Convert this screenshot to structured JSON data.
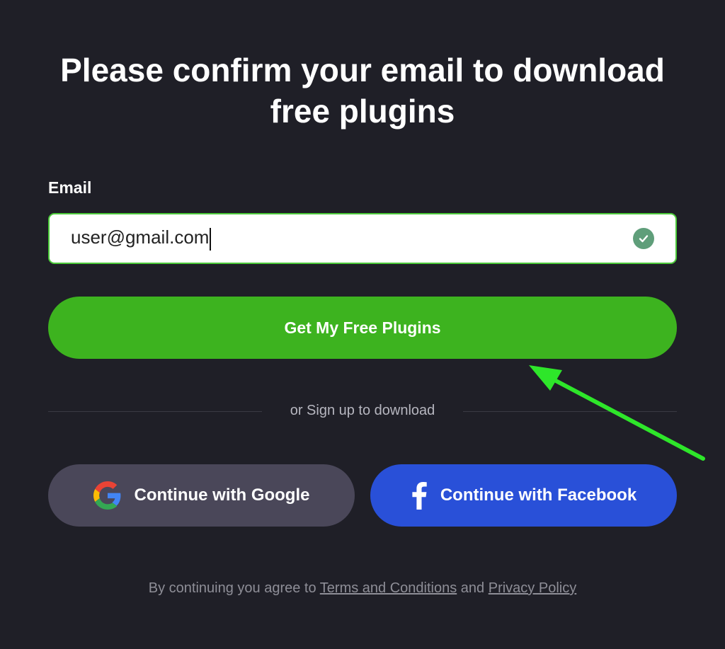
{
  "heading": "Please confirm your email to download free plugins",
  "email": {
    "label": "Email",
    "value": "user@gmail.com",
    "valid_icon": "check-circle-icon"
  },
  "primary_button": {
    "label": "Get My Free Plugins",
    "color": "#3db31f"
  },
  "divider_text": "or Sign up to download",
  "social": {
    "google": {
      "label": "Continue with Google",
      "icon": "google-icon",
      "color": "#4a4759"
    },
    "facebook": {
      "label": "Continue with Facebook",
      "icon": "facebook-icon",
      "color": "#2950d8"
    }
  },
  "footer": {
    "prefix": "By continuing you agree to",
    "terms_link": "Terms and Conditions",
    "and_text": "and",
    "privacy_link": "Privacy Policy"
  },
  "annotation": {
    "arrow_color": "#2ee62a",
    "arrow_icon": "arrow-annotation-icon"
  }
}
